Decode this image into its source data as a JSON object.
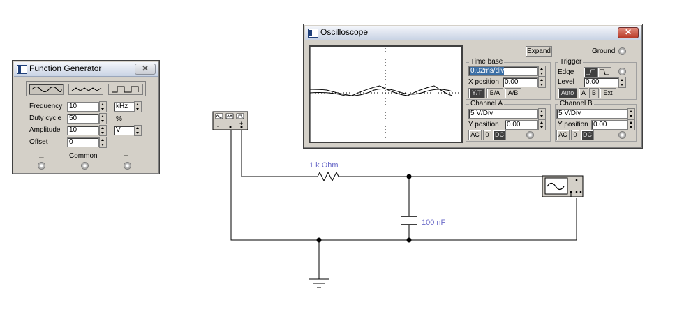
{
  "function_generator": {
    "title": "Function Generator",
    "close": "✕",
    "waveforms": [
      "sine",
      "triangle",
      "square"
    ],
    "frequency": {
      "label": "Frequency",
      "value": "10",
      "unit": "kHz"
    },
    "duty_cycle": {
      "label": "Duty cycle",
      "value": "50",
      "unit": "%"
    },
    "amplitude": {
      "label": "Amplitude",
      "value": "10",
      "unit": "V"
    },
    "offset": {
      "label": "Offset",
      "value": "0"
    },
    "terminals": {
      "minus": "–",
      "common": "Common",
      "plus": "+"
    }
  },
  "oscilloscope": {
    "title": "Oscilloscope",
    "close": "✕",
    "expand": "Expand",
    "ground": "Ground",
    "time_base": {
      "label": "Time base",
      "value": "0.02ms/div",
      "x_position_label": "X position",
      "x_position": "0.00",
      "modes": [
        "Y/T",
        "B/A",
        "A/B"
      ]
    },
    "trigger": {
      "label": "Trigger",
      "edge_label": "Edge",
      "level_label": "Level",
      "level": "0.00",
      "sources": [
        "Auto",
        "A",
        "B",
        "Ext"
      ]
    },
    "channel_a": {
      "label": "Channel A",
      "value": "5  V/Div",
      "y_position_label": "Y position",
      "y_position": "0.00",
      "coupling": [
        "AC",
        "0",
        "DC"
      ]
    },
    "channel_b": {
      "label": "Channel B",
      "value": "5  V/Div",
      "y_position_label": "Y position",
      "y_position": "0.00",
      "coupling": [
        "AC",
        "0",
        "DC"
      ]
    }
  },
  "circuit": {
    "resistor_label": "1 k Ohm",
    "capacitor_label": "100 nF",
    "generator_symbol": {
      "minus": "-",
      "plus": "+"
    }
  }
}
